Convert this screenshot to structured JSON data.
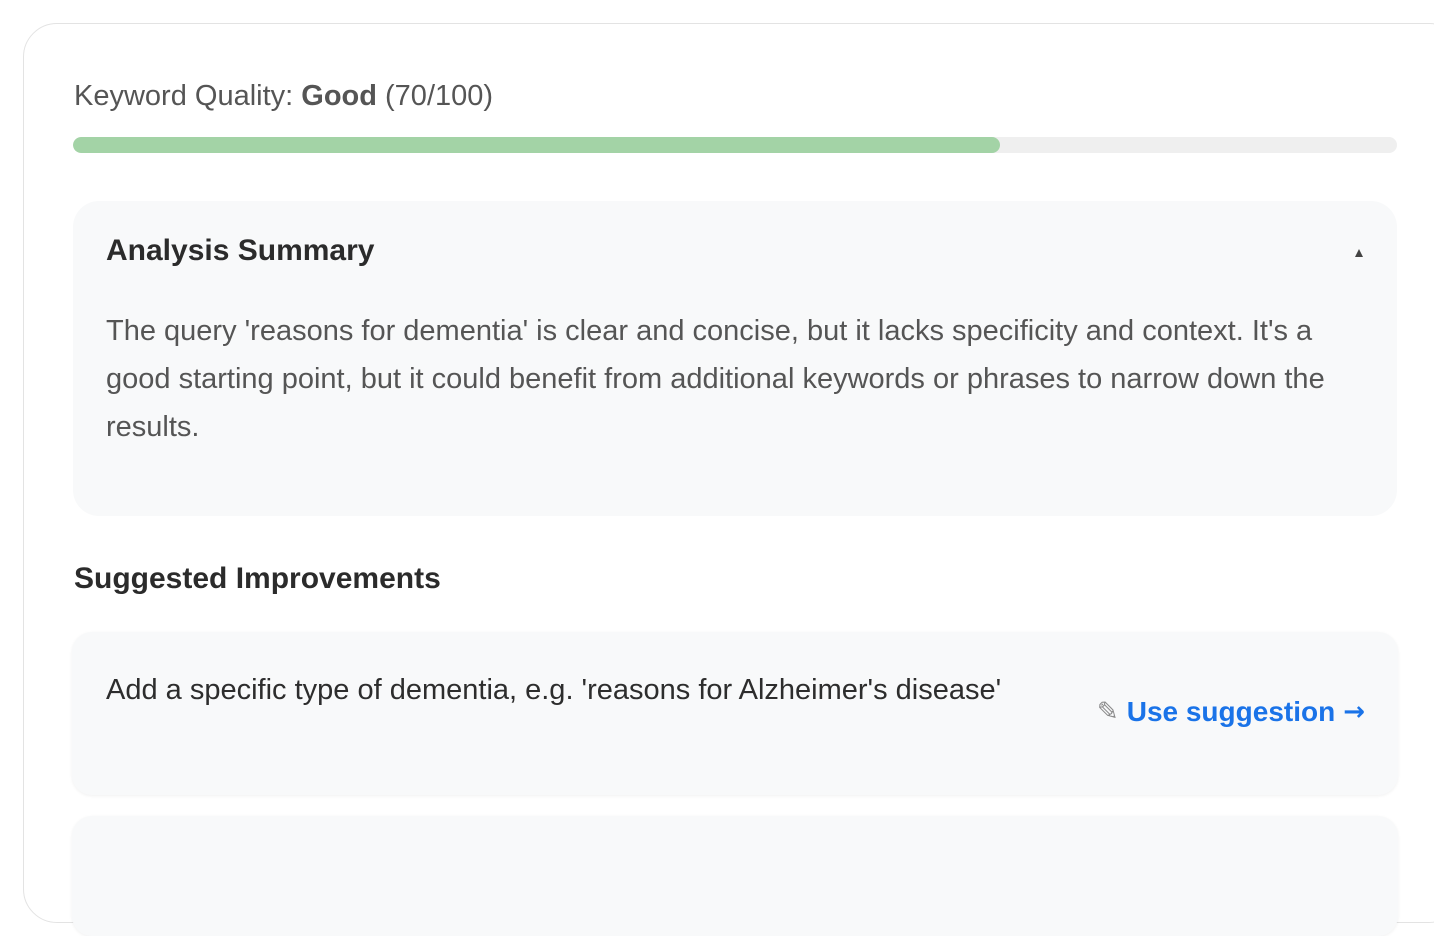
{
  "quality": {
    "label": "Keyword Quality: ",
    "rating": "Good",
    "score_text": " (70/100)",
    "score": 70,
    "max": 100,
    "progress_fraction": 0.7,
    "progress_color": "#a3d3a6"
  },
  "summary": {
    "title": "Analysis Summary",
    "toggle_icon": "triangle-up-icon",
    "expanded": true,
    "text": "The query 'reasons for dementia' is clear and concise, but it lacks specificity and context. It's a good starting point, but it could benefit from additional keywords or phrases to narrow down the results."
  },
  "improvements": {
    "heading": "Suggested Improvements",
    "items": [
      {
        "text": "Add a specific type of dementia, e.g. 'reasons for Alzheimer's disease'",
        "action_icon": "pencil-icon",
        "action_label": "Use suggestion",
        "action_arrow": "→"
      }
    ]
  },
  "colors": {
    "accent": "#1a73e8",
    "panel_background": "#f8f9fa",
    "progress_track": "#efefef"
  }
}
